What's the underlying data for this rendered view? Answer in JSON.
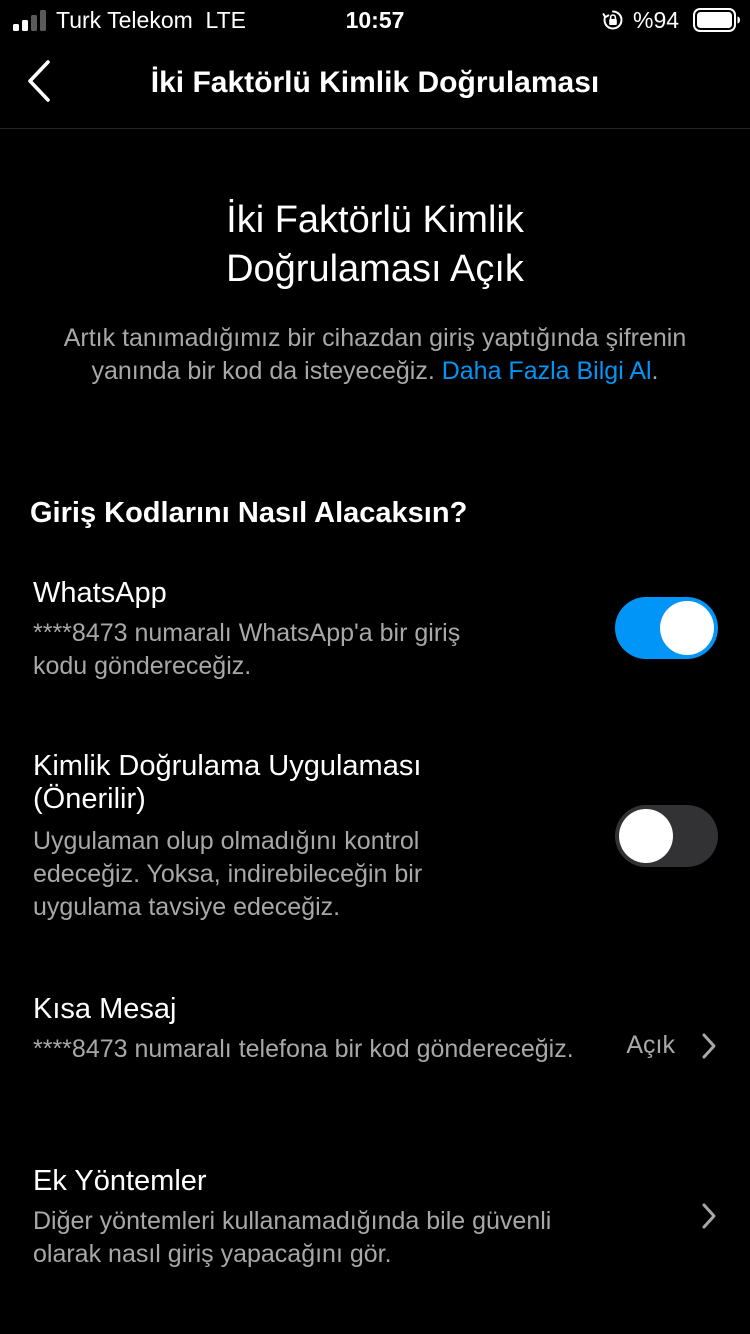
{
  "status_bar": {
    "carrier": "Turk Telekom",
    "network": "LTE",
    "time": "10:57",
    "battery": "%94",
    "icons": [
      "signal-icon",
      "orientation-lock-icon",
      "battery-icon"
    ]
  },
  "nav": {
    "back_icon": "chevron-left-icon",
    "title": "İki Faktörlü Kimlik Doğrulaması"
  },
  "hero": {
    "title_line1": "İki Faktörlü Kimlik",
    "title_line2": "Doğrulaması Açık",
    "desc": "Artık tanımadığımız bir cihazdan giriş yaptığında şifrenin yanında bir kod da isteyeceğiz.",
    "link": "Daha Fazla Bilgi Al",
    "link_suffix": "."
  },
  "section_header": "Giriş Kodlarını Nasıl Alacaksın?",
  "options": {
    "whatsapp": {
      "title": "WhatsApp",
      "desc_line1": "****8473 numaralı WhatsApp'a bir giriş",
      "desc_line2": "kodu göndereceğiz.",
      "enabled": true
    },
    "auth_app": {
      "title_line1": "Kimlik Doğrulama Uygulaması",
      "title_line2": "(Önerilir)",
      "desc_line1": "Uygulaman olup olmadığını kontrol",
      "desc_line2": "edeceğiz. Yoksa, indirebileceğin bir",
      "desc_line3": "uygulama tavsiye edeceğiz.",
      "enabled": false
    },
    "sms": {
      "title": "Kısa Mesaj",
      "desc": "****8473 numaralı telefona bir kod göndereceğiz.",
      "status": "Açık"
    },
    "extra": {
      "title": "Ek Yöntemler",
      "desc_line1": "Diğer yöntemleri kullanamadığında bile güvenli",
      "desc_line2": "olarak nasıl giriş yapacağını gör."
    }
  },
  "colors": {
    "background": "#000000",
    "text_primary": "#ffffff",
    "text_secondary": "#a8a8a8",
    "accent": "#0095f6",
    "toggle_off": "#323235"
  }
}
